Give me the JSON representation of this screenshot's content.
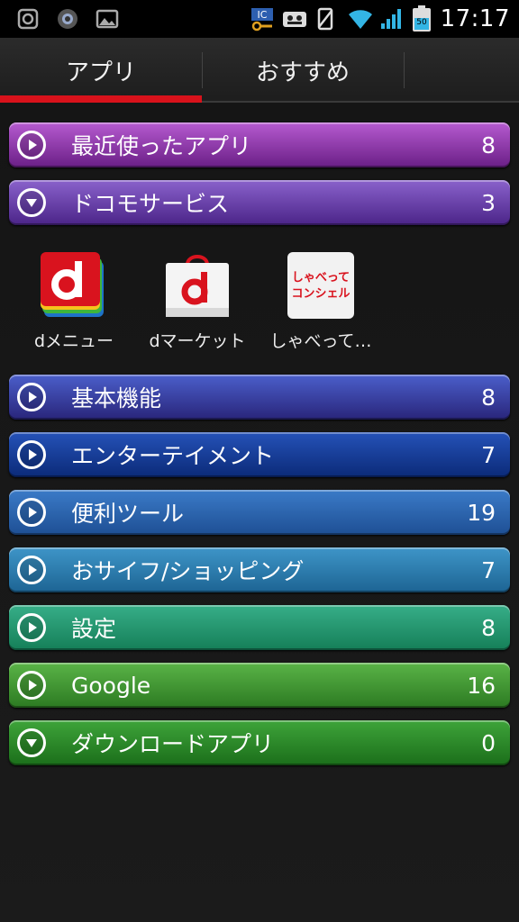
{
  "status_bar": {
    "time": "17:17",
    "battery_level": "50",
    "ic_label": "IC"
  },
  "tabs": [
    {
      "label": "アプリ",
      "selected": true
    },
    {
      "label": "おすすめ",
      "selected": false
    }
  ],
  "categories": [
    {
      "label": "最近使ったアプリ",
      "count": "8",
      "expanded": false,
      "color_top": "#b65ad0",
      "color_bottom": "#6a1f86"
    },
    {
      "label": "ドコモサービス",
      "count": "3",
      "expanded": true,
      "color_top": "#8a62cc",
      "color_bottom": "#4b2488"
    },
    {
      "label": "基本機能",
      "count": "8",
      "expanded": false,
      "color_top": "#4b5fcb",
      "color_bottom": "#29257a"
    },
    {
      "label": "エンターテイメント",
      "count": "7",
      "expanded": false,
      "color_top": "#2552b8",
      "color_bottom": "#0b2a78"
    },
    {
      "label": "便利ツール",
      "count": "19",
      "expanded": false,
      "color_top": "#3b7bc8",
      "color_bottom": "#1e4f94"
    },
    {
      "label": "おサイフ/ショッピング",
      "count": "7",
      "expanded": false,
      "color_top": "#3e95c8",
      "color_bottom": "#1d6493"
    },
    {
      "label": "設定",
      "count": "8",
      "expanded": false,
      "color_top": "#37ae88",
      "color_bottom": "#157f58"
    },
    {
      "label": "Google",
      "count": "16",
      "expanded": false,
      "color_top": "#5ab447",
      "color_bottom": "#2c7a22"
    },
    {
      "label": "ダウンロードアプリ",
      "count": "0",
      "expanded": true,
      "color_top": "#3ea43a",
      "color_bottom": "#1b6e1a"
    }
  ],
  "docomo_apps": [
    {
      "name": "dメニュー",
      "icon": "d-menu-icon"
    },
    {
      "name": "dマーケット",
      "icon": "d-market-icon"
    },
    {
      "name": "しゃべって…",
      "icon": "shabette-concier-icon",
      "icon_text_top": "しゃべって",
      "icon_text_bottom": "コンシェル"
    }
  ]
}
